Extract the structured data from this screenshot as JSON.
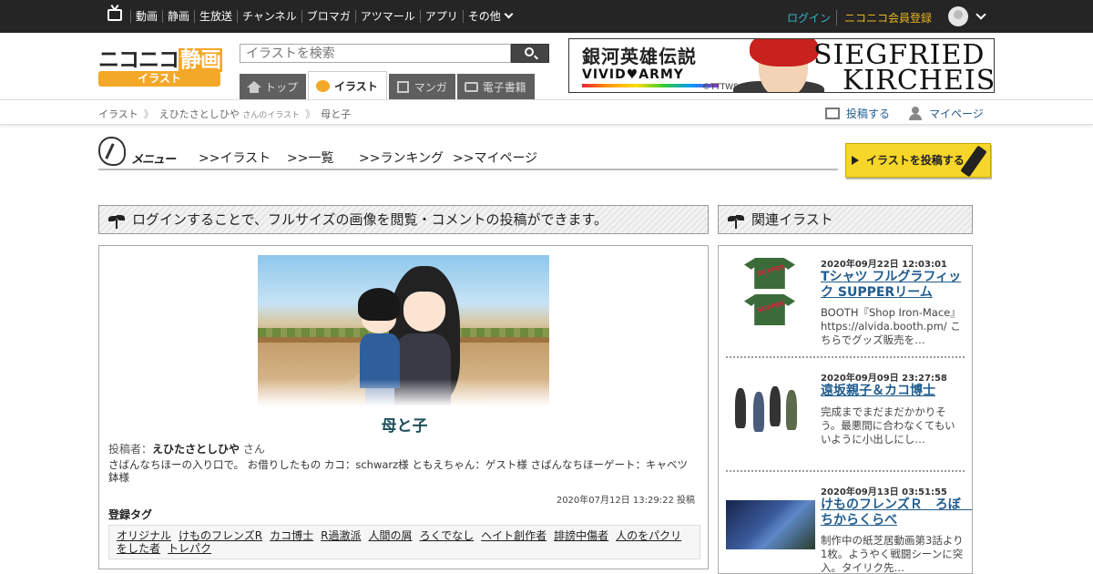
{
  "topbar": {
    "nav": [
      "動画",
      "静画",
      "生放送",
      "チャンネル",
      "ブロマガ",
      "アツマール",
      "アプリ",
      "その他"
    ],
    "login": "ログイン",
    "register": "ニコニコ会員登録"
  },
  "header": {
    "logo_main_a": "ニコニコ",
    "logo_main_b": "静画",
    "logo_sub": "イラスト",
    "search_placeholder": "イラストを検索",
    "tabs": [
      {
        "label": "トップ",
        "icon": "home-icon"
      },
      {
        "label": "イラスト",
        "icon": "palette-icon"
      },
      {
        "label": "マンガ",
        "icon": "manga-icon"
      },
      {
        "label": "電子書籍",
        "icon": "book-icon"
      }
    ]
  },
  "banner": {
    "title_jp": "銀河英雄伝説",
    "subtitle": "VIVID♥ARMY",
    "copyright": "©TTTWS,©K",
    "name_line1": "SIEGFRIED",
    "name_line2": "KIRCHEIS"
  },
  "breadcrumb": {
    "root": "イラスト",
    "user": "えひたさとしひや",
    "user_suffix": "さんのイラスト",
    "current": "母と子",
    "post_link": "投稿する",
    "mypage_link": "マイページ"
  },
  "menu": {
    "label": "メニュー",
    "links": [
      ">>イラスト",
      ">>一覧",
      ">>ランキング",
      ">>マイページ"
    ],
    "post_button": "イラストを投稿する"
  },
  "main": {
    "notice": "ログインすることで、フルサイズの画像を閲覧・コメントの投稿ができます。",
    "title": "母と子",
    "poster_label": "投稿者：",
    "poster_name": "えひたさとしひや",
    "poster_suffix": "さん",
    "description": "さばんなちほーの入り口で。 お借りしたもの カコ：schwarz様 ともえちゃん：ゲスト様 さばんなちほーゲート：キャベツ鉢様",
    "posted": "2020年07月12日 13:29:22 投稿",
    "tags_label": "登録タグ",
    "tags": [
      "オリジナル",
      "けものフレンズR",
      "カコ博士",
      "R過激派",
      "人間の屑",
      "ろくでなし",
      "ヘイト創作者",
      "誹謗中傷者",
      "人のをパクリをした者",
      "トレパク"
    ]
  },
  "related": {
    "heading": "関連イラスト",
    "items": [
      {
        "date": "2020年09月22日 12:03:01",
        "title": "Tシャツ フルグラフィック SUPPERリーム",
        "desc": "BOOTH『Shop Iron-Mace』https://alvida.booth.pm/ こちらでグッズ販売を…"
      },
      {
        "date": "2020年09月09日 23:27:58",
        "title": "遠坂親子＆カコ博士",
        "desc": "完成までまだまだかかりそう。最悪間に合わなくてもいいように小出しにし…"
      },
      {
        "date": "2020年09月13日 03:51:55",
        "title": "けものフレンズＲ　ろぼ　ちからくらべ",
        "desc": "制作中の紙芝居動画第3話より1枚。ようやく戦闘シーンに突入。タイリク先…"
      }
    ]
  },
  "colors": {
    "topbar_bg": "#252525",
    "accent_orange": "#f3a829",
    "login_cyan": "#33b3c7",
    "register_yellow": "#e8b523",
    "link_blue": "#215d8f",
    "post_button_yellow": "#f7d62a"
  }
}
